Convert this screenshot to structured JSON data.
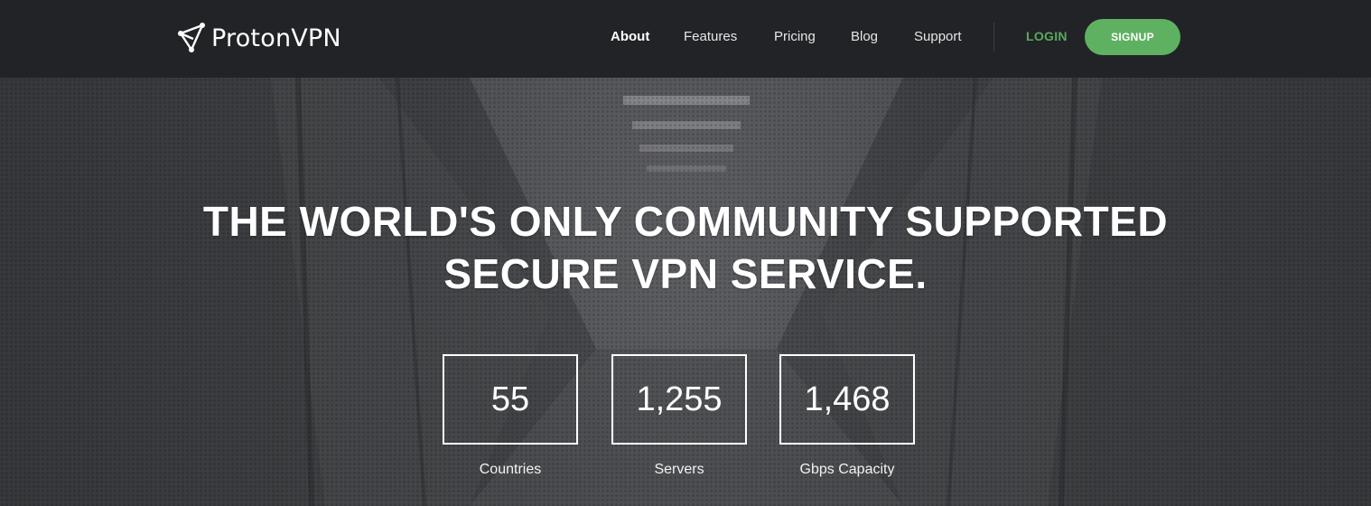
{
  "brand": {
    "name": "ProtonVPN",
    "logo_icon": "proton-triangle-logo"
  },
  "nav": {
    "items": [
      {
        "label": "About",
        "active": true
      },
      {
        "label": "Features",
        "active": false
      },
      {
        "label": "Pricing",
        "active": false
      },
      {
        "label": "Blog",
        "active": false
      },
      {
        "label": "Support",
        "active": false
      }
    ],
    "login_label": "LOGIN",
    "signup_label": "SIGNUP"
  },
  "hero": {
    "headline_line1": "THE WORLD'S ONLY COMMUNITY SUPPORTED",
    "headline_line2": "SECURE VPN SERVICE.",
    "stats": [
      {
        "value": "55",
        "label": "Countries"
      },
      {
        "value": "1,255",
        "label": "Servers"
      },
      {
        "value": "1,468",
        "label": "Gbps Capacity"
      }
    ]
  },
  "colors": {
    "navbar_bg": "#222327",
    "accent_green": "#5fb162",
    "login_green": "#5ba85f",
    "text_white": "#ffffff"
  }
}
